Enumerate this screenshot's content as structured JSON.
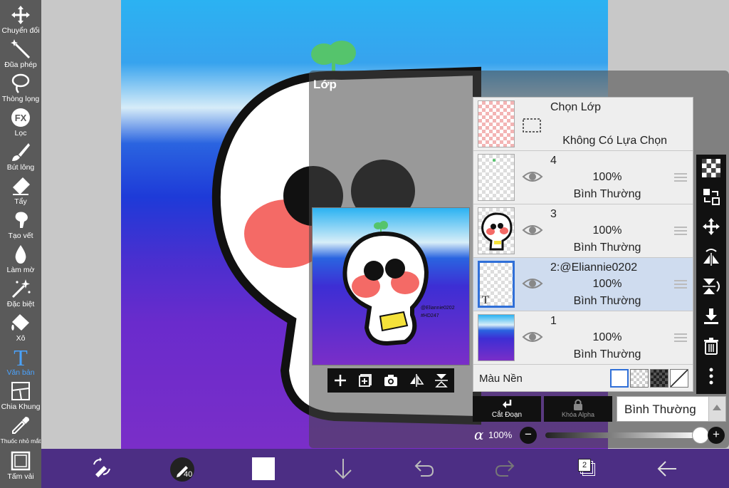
{
  "tools": [
    {
      "label": "Chuyển đổi",
      "icon": "move-icon"
    },
    {
      "label": "Đũa phép",
      "icon": "magic-wand-icon"
    },
    {
      "label": "Thòng lọng",
      "icon": "lasso-icon"
    },
    {
      "label": "Lọc",
      "icon": "fx-filter-icon",
      "glyph": "FX"
    },
    {
      "label": "Bút lông",
      "icon": "brush-icon"
    },
    {
      "label": "Tẩy",
      "icon": "eraser-icon"
    },
    {
      "label": "Tạo vết",
      "icon": "smudge-icon"
    },
    {
      "label": "Làm mờ",
      "icon": "blur-drop-icon"
    },
    {
      "label": "Đặc biệt",
      "icon": "special-sparkle-icon"
    },
    {
      "label": "Xô",
      "icon": "bucket-icon"
    },
    {
      "label": "Văn bản",
      "icon": "text-icon",
      "glyph": "T",
      "active": true
    },
    {
      "label": "Chia Khung",
      "icon": "frame-divider-icon"
    },
    {
      "label": "Thuốc nhỏ mắt",
      "icon": "eyedropper-icon"
    },
    {
      "label": "Tấm vải",
      "icon": "canvas-icon"
    }
  ],
  "layer_panel": {
    "title": "Lớp",
    "selection_row": {
      "title": "Chọn Lớp",
      "status": "Không Có Lựa Chọn"
    },
    "layers": [
      {
        "name": "4",
        "opacity": "100%",
        "mode": "Bình Thường",
        "selected": false
      },
      {
        "name": "3",
        "opacity": "100%",
        "mode": "Bình Thường",
        "selected": false
      },
      {
        "name": "2:@Eliannie0202",
        "opacity": "100%",
        "mode": "Bình Thường",
        "selected": true
      },
      {
        "name": "1",
        "opacity": "100%",
        "mode": "Bình Thường",
        "selected": false
      }
    ],
    "background_label": "Màu Nền",
    "clip_label": "Cắt Đoạn",
    "alpha_lock_label": "Khóa Alpha",
    "blend_mode": "Bình Thường",
    "alpha_symbol": "α",
    "alpha_value": "100%",
    "alpha_fraction": 1.0
  },
  "preview": {
    "watermark_line1": "@Eliannie0202",
    "watermark_line2": "#HD247"
  },
  "bottombar": {
    "brush_size": "40",
    "layers_count": "2",
    "primary_color": "#ffffff"
  },
  "colors": {
    "toolbar_bg": "#5a5a5a",
    "active_tool": "#4aa3ff",
    "bottombar_bg": "#4c2e84",
    "selected_layer": "#cfdcef",
    "selected_border": "#2f6fd8"
  }
}
